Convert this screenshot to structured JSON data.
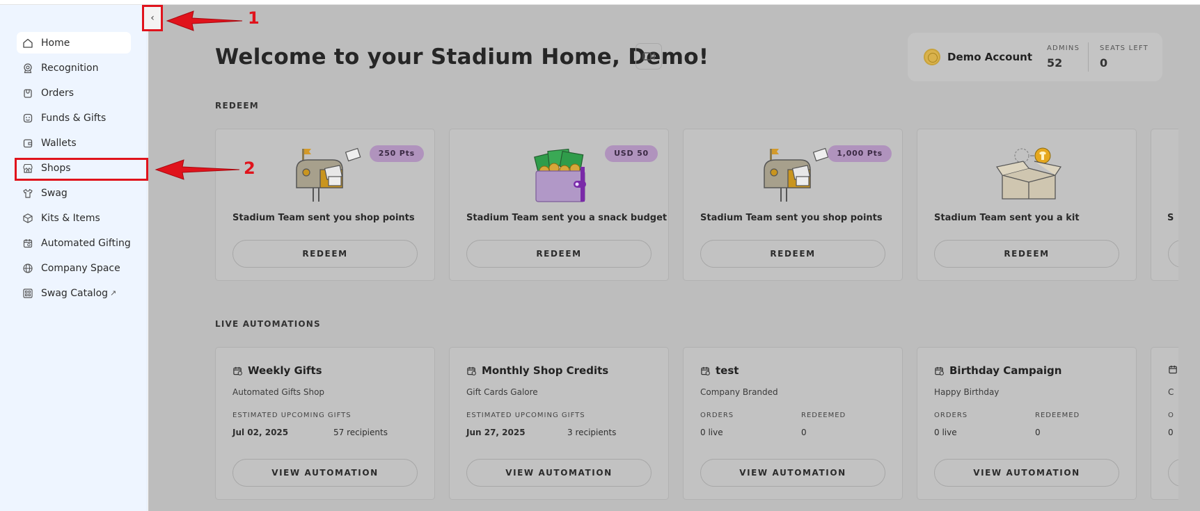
{
  "sidebar": {
    "items": [
      {
        "label": "Home",
        "icon": "home-icon",
        "active": true
      },
      {
        "label": "Recognition",
        "icon": "badge-icon"
      },
      {
        "label": "Orders",
        "icon": "bag-icon"
      },
      {
        "label": "Funds & Gifts",
        "icon": "gift-icon"
      },
      {
        "label": "Wallets",
        "icon": "wallet-icon"
      },
      {
        "label": "Shops",
        "icon": "store-icon"
      },
      {
        "label": "Swag",
        "icon": "tshirt-icon"
      },
      {
        "label": "Kits & Items",
        "icon": "box-icon"
      },
      {
        "label": "Automated Gifting",
        "icon": "calendar-icon"
      },
      {
        "label": "Company Space",
        "icon": "globe-icon"
      },
      {
        "label": "Swag Catalog",
        "icon": "grid-icon",
        "external": "↗"
      }
    ]
  },
  "header": {
    "title": "Welcome to your Stadium Home, Demo!",
    "collapse_glyph": "‹"
  },
  "account": {
    "name": "Demo Account",
    "admins_label": "ADMINS",
    "admins_value": "52",
    "seats_label": "SEATS LEFT",
    "seats_value": "0"
  },
  "redeem": {
    "section_label": "REDEEM",
    "button_label": "REDEEM",
    "cards": [
      {
        "badge": "250 Pts",
        "title": "Stadium Team sent you shop points",
        "art": "mailbox-icon"
      },
      {
        "badge": "USD 50",
        "title": "Stadium Team sent you a snack budget",
        "art": "wallet-cash-icon"
      },
      {
        "badge": "1,000 Pts",
        "title": "Stadium Team sent you shop points",
        "art": "mailbox-icon"
      },
      {
        "badge": "",
        "title": "Stadium Team sent you a kit",
        "art": "box-kit-icon"
      }
    ],
    "partial_title_char": "S"
  },
  "automations": {
    "section_label": "LIVE AUTOMATIONS",
    "button_label": "VIEW AUTOMATION",
    "cards": [
      {
        "title": "Weekly Gifts",
        "subtitle": "Automated Gifts Shop",
        "label_a": "ESTIMATED UPCOMING GIFTS",
        "val_a": "Jul 02, 2025",
        "val_b": "57 recipients"
      },
      {
        "title": "Monthly Shop Credits",
        "subtitle": "Gift Cards Galore",
        "label_a": "ESTIMATED UPCOMING GIFTS",
        "val_a": "Jun 27, 2025",
        "val_b": "3 recipients"
      },
      {
        "title": "test",
        "subtitle": "Company Branded",
        "label_a": "ORDERS",
        "label_b": "REDEEMED",
        "val_a": "0 live",
        "val_b": "0"
      },
      {
        "title": "Birthday Campaign",
        "subtitle": "Happy Birthday",
        "label_a": "ORDERS",
        "label_b": "REDEEMED",
        "val_a": "0 live",
        "val_b": "0"
      }
    ],
    "partial_sub_char": "C",
    "partial_label_char": "O",
    "partial_val_char": "0"
  },
  "annotations": {
    "first": "1",
    "second": "2"
  },
  "colors": {
    "highlight": "#e0131c",
    "badge": "#b093bd",
    "sidebar_bg": "#eef5ff",
    "overlay": "#bdbdbd"
  }
}
